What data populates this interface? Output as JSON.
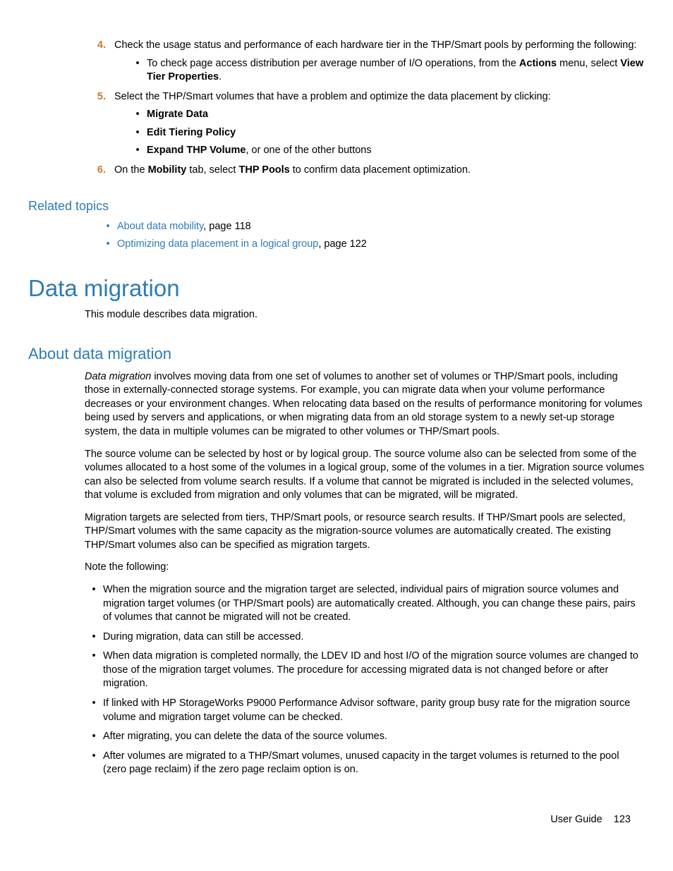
{
  "steps": {
    "s4": {
      "num": "4.",
      "text_a": "Check the usage status and performance of each hardware tier in the THP/Smart pools by performing the following:",
      "sub_a_pre": "To check page access distribution per average number of I/O operations, from the ",
      "sub_a_bold1": "Actions",
      "sub_a_mid": " menu, select ",
      "sub_a_bold2": "View Tier Properties",
      "sub_a_post": "."
    },
    "s5": {
      "num": "5.",
      "text": "Select the THP/Smart volumes that have a problem and optimize the data placement by clicking:",
      "b1": "Migrate Data",
      "b2": "Edit Tiering Policy",
      "b3_bold": "Expand THP Volume",
      "b3_rest": ", or one of the other buttons"
    },
    "s6": {
      "num": "6.",
      "pre": "On the ",
      "bold1": "Mobility",
      "mid": " tab, select ",
      "bold2": "THP Pools",
      "post": " to confirm data placement optimization."
    }
  },
  "related": {
    "heading": "Related topics",
    "r1_link": "About data mobility",
    "r1_rest": ", page 118",
    "r2_link": "Optimizing data placement in a logical group",
    "r2_rest": ", page 122"
  },
  "h1": "Data migration",
  "h1_sub": "This module describes data migration.",
  "h2": "About data migration",
  "para1_ital": "Data migration",
  "para1_rest": " involves moving data from one set of volumes to another set of volumes or THP/Smart pools, including those in externally-connected storage systems. For example, you can migrate data when your volume performance decreases or your environment changes. When relocating data based on the results of performance monitoring for volumes being used by servers and applications, or when migrating data from an old storage system to a newly set-up storage system, the data in multiple volumes can be migrated to other volumes or THP/Smart pools.",
  "para2": "The source volume can be selected by host or by logical group. The source volume also can be selected from some of the volumes allocated to a host some of the volumes in a logical group, some of the volumes in a tier. Migration source volumes can also be selected from volume search results. If a volume that cannot be migrated is included in the selected volumes, that volume is excluded from migration and only volumes that can be migrated, will be migrated.",
  "para3": "Migration targets are selected from tiers, THP/Smart pools, or resource search results. If THP/Smart pools are selected, THP/Smart volumes with the same capacity as the migration-source volumes are automatically created. The existing THP/Smart volumes also can be specified as migration targets.",
  "note_intro": "Note the following:",
  "notes": {
    "n1": "When the migration source and the migration target are selected, individual pairs of migration source volumes and migration target volumes (or THP/Smart pools) are automatically created. Although, you can change these pairs, pairs of volumes that cannot be migrated will not be created.",
    "n2": "During migration, data can still be accessed.",
    "n3": "When data migration is completed normally, the LDEV ID and host I/O of the migration source volumes are changed to those of the migration target volumes. The procedure for accessing migrated data is not changed before or after migration.",
    "n4": "If linked with HP StorageWorks P9000 Performance Advisor software, parity group busy rate for the migration source volume and migration target volume can be checked.",
    "n5": "After migrating, you can delete the data of the source volumes.",
    "n6": "After volumes are migrated to a THP/Smart volumes, unused capacity in the target volumes is returned to the pool (zero page reclaim) if the zero page reclaim option is on."
  },
  "footer": {
    "label": "User Guide",
    "page": "123"
  }
}
